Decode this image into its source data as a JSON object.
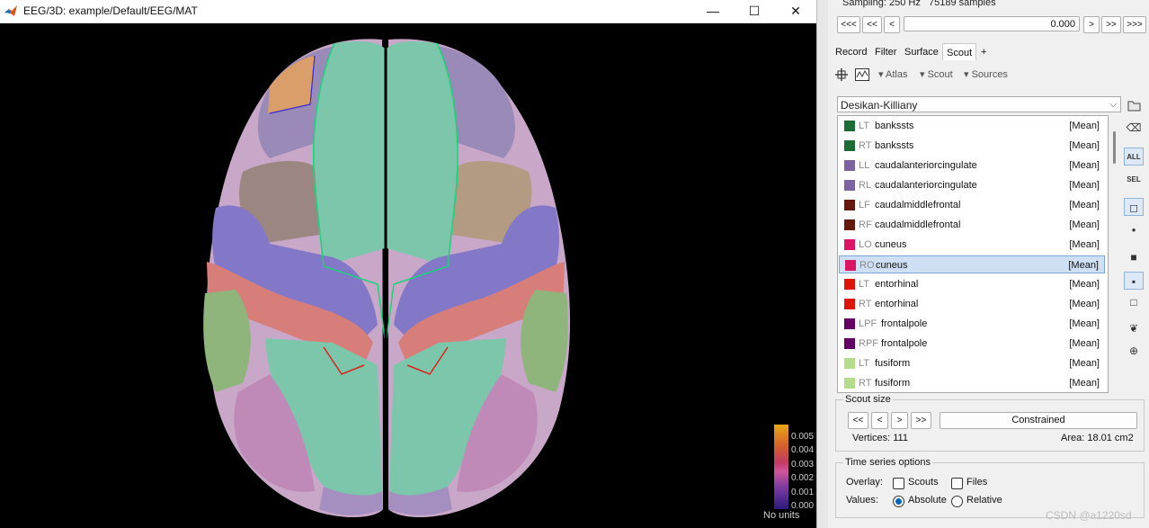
{
  "figure_window": {
    "title": "EEG/3D: example/Default/EEG/MAT",
    "minimize": "—",
    "maximize": "☐",
    "close": "✕"
  },
  "colorbar": {
    "ticks": [
      "0.005",
      "0.004",
      "0.003",
      "0.002",
      "0.001",
      "0.000"
    ],
    "units": "No units"
  },
  "header": {
    "sampling": "Sampling: 250 Hz",
    "samples": "75189 samples",
    "nav": [
      "<<<",
      "<<",
      "<",
      ">",
      ">>",
      ">>>"
    ],
    "time_value": "0.000"
  },
  "tabs": [
    {
      "label": "Record",
      "active": false
    },
    {
      "label": "Filter",
      "active": false
    },
    {
      "label": "Surface",
      "active": false
    },
    {
      "label": "Scout",
      "active": true
    },
    {
      "label": "+",
      "active": false
    }
  ],
  "toolbar": {
    "atlas": "Atlas",
    "scout": "Scout",
    "sources": "Sources"
  },
  "atlas_select": "Desikan-Killiany",
  "scouts": [
    {
      "tag": "LT",
      "name": "bankssts",
      "fn": "[Mean]",
      "color": "#1e6b35",
      "selected": false
    },
    {
      "tag": "RT",
      "name": "bankssts",
      "fn": "[Mean]",
      "color": "#1e6b35",
      "selected": false
    },
    {
      "tag": "LL",
      "name": "caudalanteriorcingulate",
      "fn": "[Mean]",
      "color": "#7d64a0",
      "selected": false
    },
    {
      "tag": "RL",
      "name": "caudalanteriorcingulate",
      "fn": "[Mean]",
      "color": "#7d64a0",
      "selected": false
    },
    {
      "tag": "LF",
      "name": "caudalmiddlefrontal",
      "fn": "[Mean]",
      "color": "#64190a",
      "selected": false
    },
    {
      "tag": "RF",
      "name": "caudalmiddlefrontal",
      "fn": "[Mean]",
      "color": "#64190a",
      "selected": false
    },
    {
      "tag": "LO",
      "name": "cuneus",
      "fn": "[Mean]",
      "color": "#dc1464",
      "selected": false
    },
    {
      "tag": "RO",
      "name": "cuneus",
      "fn": "[Mean]",
      "color": "#dc1464",
      "selected": true
    },
    {
      "tag": "LT",
      "name": "entorhinal",
      "fn": "[Mean]",
      "color": "#dc140a",
      "selected": false
    },
    {
      "tag": "RT",
      "name": "entorhinal",
      "fn": "[Mean]",
      "color": "#dc140a",
      "selected": false
    },
    {
      "tag": "LPF",
      "name": "frontalpole",
      "fn": "[Mean]",
      "color": "#640064",
      "selected": false
    },
    {
      "tag": "RPF",
      "name": "frontalpole",
      "fn": "[Mean]",
      "color": "#640064",
      "selected": false
    },
    {
      "tag": "LT",
      "name": "fusiform",
      "fn": "[Mean]",
      "color": "#b4dc8c",
      "selected": false
    },
    {
      "tag": "RT",
      "name": "fusiform",
      "fn": "[Mean]",
      "color": "#b4dc8c",
      "selected": false
    }
  ],
  "side_buttons": {
    "all": "ALL",
    "sel": "SEL"
  },
  "scout_size": {
    "title": "Scout size",
    "buttons": [
      "<<",
      "<",
      ">",
      ">>"
    ],
    "constrained": "Constrained",
    "vertices": "Vertices: 111",
    "area": "Area: 18.01 cm2"
  },
  "time_series": {
    "title": "Time series options",
    "overlay_label": "Overlay:",
    "scouts_label": "Scouts",
    "files_label": "Files",
    "values_label": "Values:",
    "absolute_label": "Absolute",
    "relative_label": "Relative",
    "absolute_checked": true
  },
  "watermark": "CSDN @a1220sd"
}
